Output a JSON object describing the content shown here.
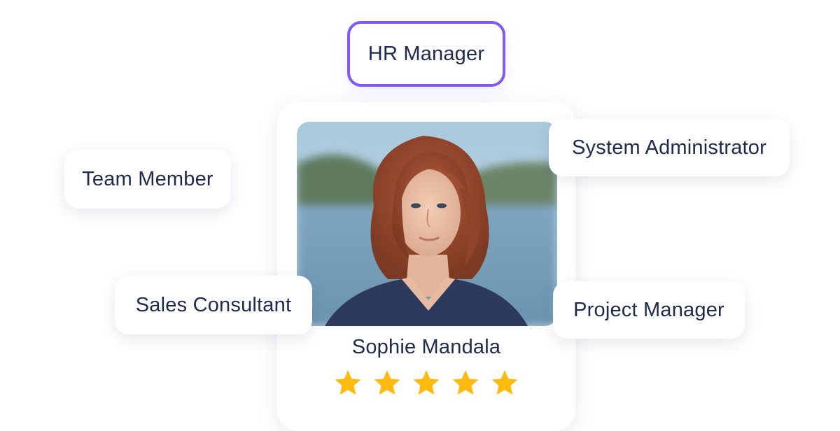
{
  "profile": {
    "name": "Sophie Mandala",
    "rating": 5,
    "max_rating": 5,
    "photo": "portrait-photo"
  },
  "roles": {
    "selected": "HR Manager",
    "hr_manager": "HR Manager",
    "team_member": "Team Member",
    "system_administrator": "System Administrator",
    "sales_consultant": "Sales Consultant",
    "project_manager": "Project Manager"
  },
  "colors": {
    "selected_border": "#7c5cf2",
    "text": "#1e2a4a",
    "star": "#fdbb12"
  },
  "icons": {
    "star": "star-icon"
  }
}
